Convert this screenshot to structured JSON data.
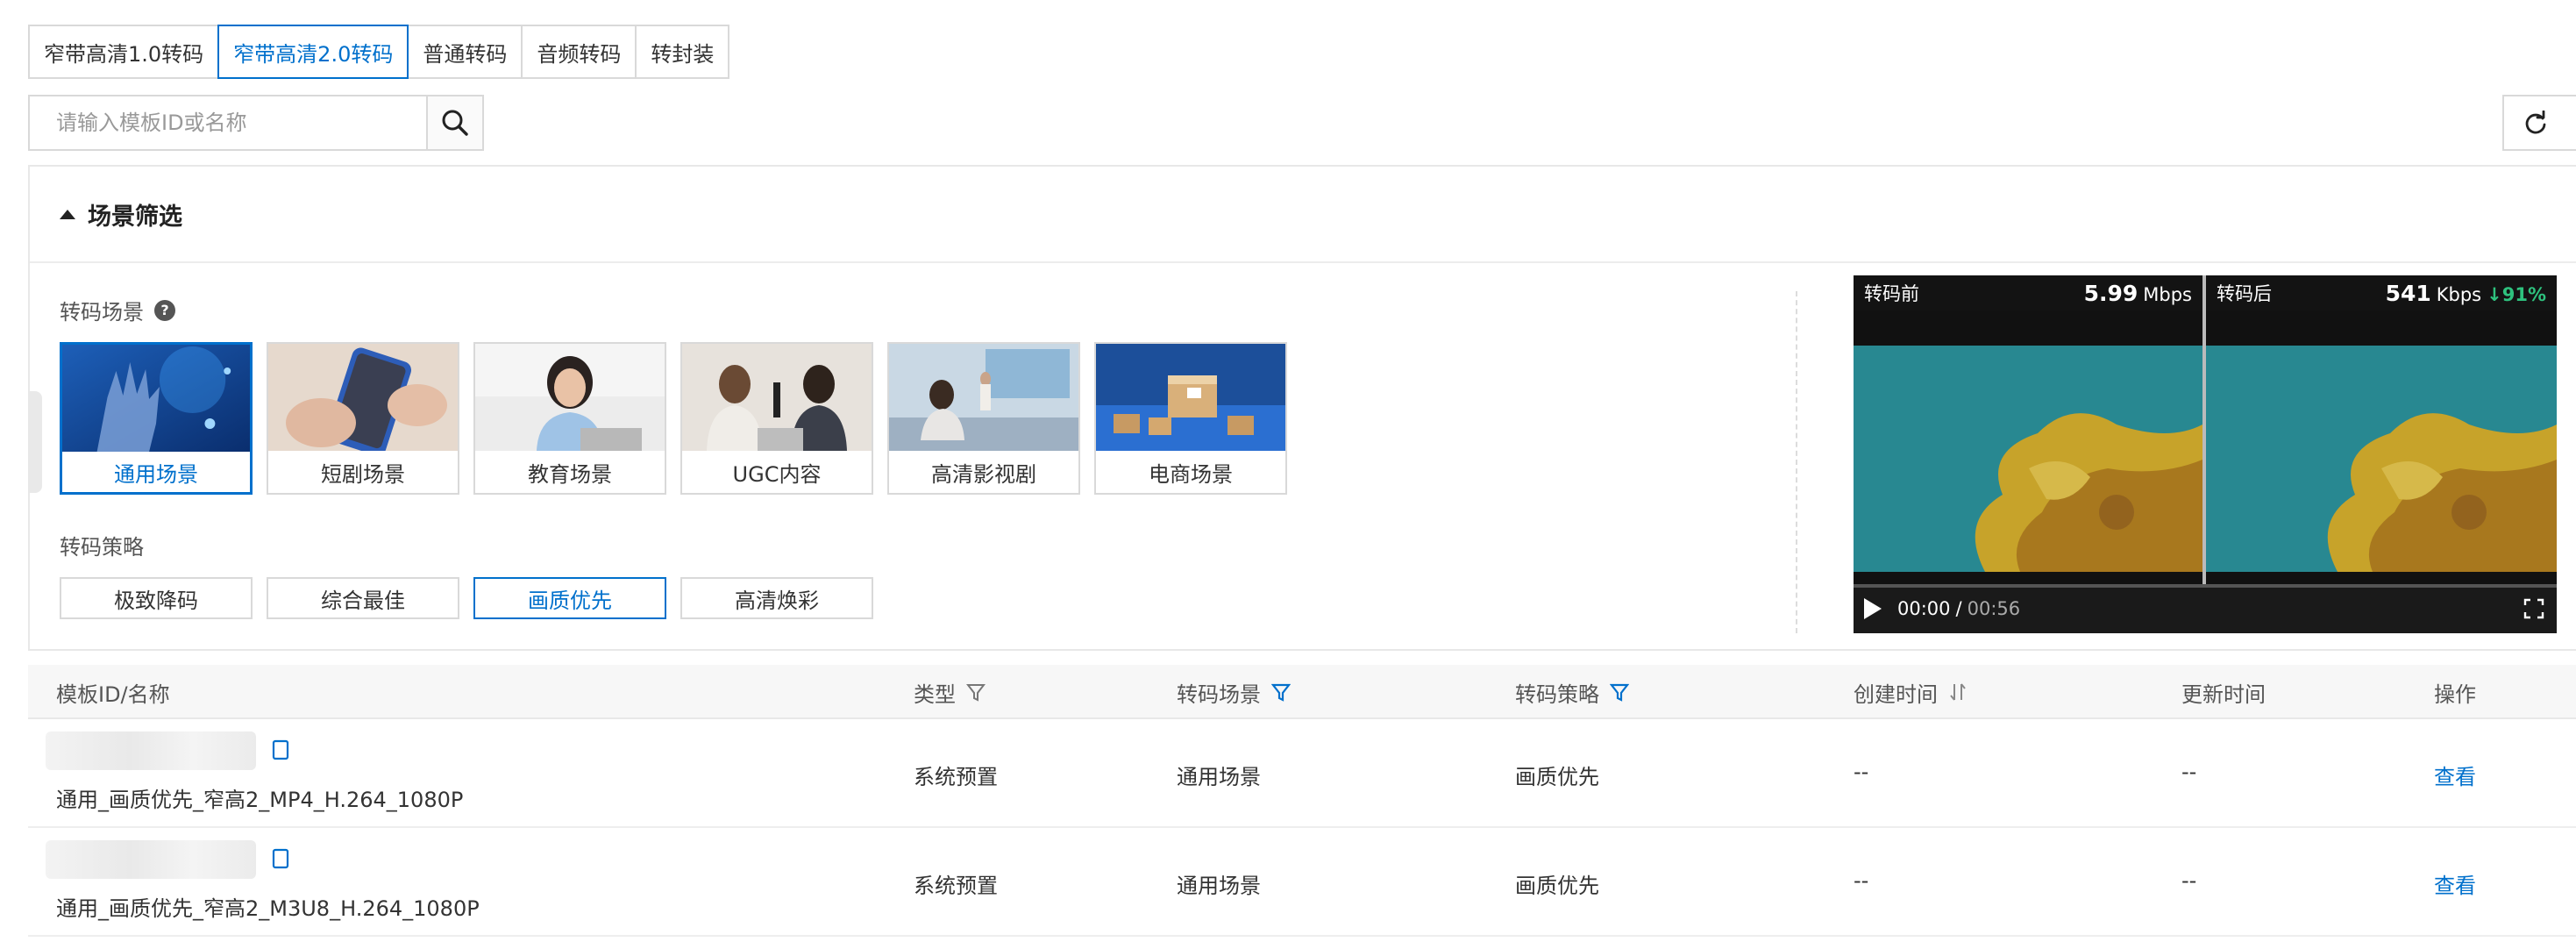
{
  "tabs": [
    {
      "label": "窄带高清1.0转码",
      "active": false
    },
    {
      "label": "窄带高清2.0转码",
      "active": true
    },
    {
      "label": "普通转码",
      "active": false
    },
    {
      "label": "音频转码",
      "active": false
    },
    {
      "label": "转封装",
      "active": false
    }
  ],
  "search": {
    "placeholder": "请输入模板ID或名称"
  },
  "filter": {
    "title": "场景筛选",
    "scene_label": "转码场景",
    "scenes": [
      {
        "label": "通用场景",
        "active": true
      },
      {
        "label": "短剧场景",
        "active": false
      },
      {
        "label": "教育场景",
        "active": false
      },
      {
        "label": "UGC内容",
        "active": false
      },
      {
        "label": "高清影视剧",
        "active": false
      },
      {
        "label": "电商场景",
        "active": false
      }
    ],
    "strategy_label": "转码策略",
    "strategies": [
      {
        "label": "极致降码",
        "active": false
      },
      {
        "label": "综合最佳",
        "active": false
      },
      {
        "label": "画质优先",
        "active": true
      },
      {
        "label": "高清焕彩",
        "active": false
      }
    ]
  },
  "video": {
    "before_label": "转码前",
    "before_value": "5.99",
    "before_unit": "Mbps",
    "after_label": "转码后",
    "after_value": "541",
    "after_unit": "Kbps",
    "reduction": "↓91%",
    "current_time": "00:00",
    "separator": "/",
    "total_time": "00:56",
    "progress": 0
  },
  "table": {
    "headers": {
      "name": "模板ID/名称",
      "type": "类型",
      "scene": "转码场景",
      "strategy": "转码策略",
      "created": "创建时间",
      "updated": "更新时间",
      "action": "操作"
    },
    "rows": [
      {
        "name": "通用_画质优先_窄高2_MP4_H.264_1080P",
        "type": "系统预置",
        "scene": "通用场景",
        "strategy": "画质优先",
        "created": "--",
        "updated": "--",
        "action": "查看"
      },
      {
        "name": "通用_画质优先_窄高2_M3U8_H.264_1080P",
        "type": "系统预置",
        "scene": "通用场景",
        "strategy": "画质优先",
        "created": "--",
        "updated": "--",
        "action": "查看"
      }
    ]
  },
  "colors": {
    "accent": "#0070cc",
    "reduction": "#2ec27e",
    "border": "#d9d9d9"
  }
}
